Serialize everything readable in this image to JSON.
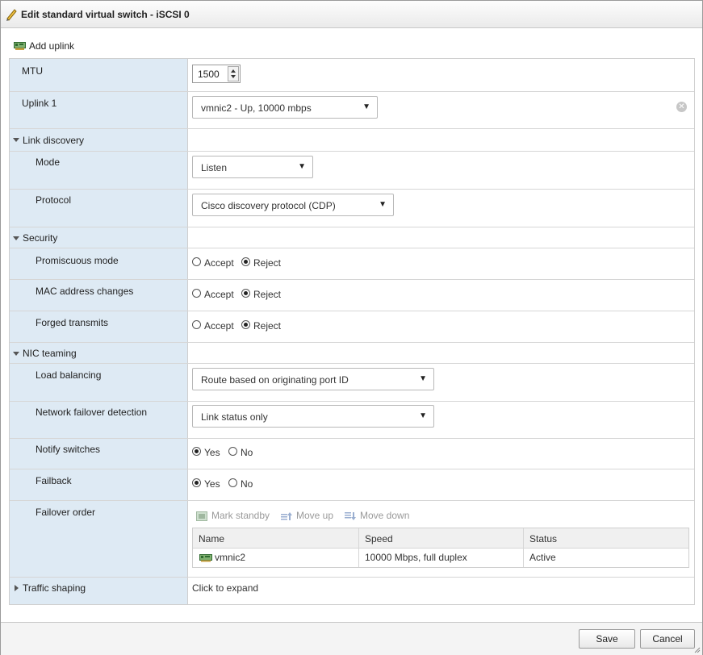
{
  "dialog": {
    "title": "Edit standard virtual switch - iSCSI 0"
  },
  "toolbar": {
    "add_uplink": "Add uplink"
  },
  "rows": {
    "mtu": {
      "label": "MTU",
      "value": "1500"
    },
    "uplink1": {
      "label": "Uplink 1",
      "value": "vmnic2 - Up, 10000 mbps"
    },
    "link_discovery": {
      "label": "Link discovery",
      "mode": {
        "label": "Mode",
        "value": "Listen"
      },
      "protocol": {
        "label": "Protocol",
        "value": "Cisco discovery protocol (CDP)"
      }
    },
    "security": {
      "label": "Security",
      "promiscuous": {
        "label": "Promiscuous mode",
        "selected": "Reject"
      },
      "mac_changes": {
        "label": "MAC address changes",
        "selected": "Reject"
      },
      "forged": {
        "label": "Forged transmits",
        "selected": "Reject"
      },
      "accept_label": "Accept",
      "reject_label": "Reject"
    },
    "nic_teaming": {
      "label": "NIC teaming",
      "load_balancing": {
        "label": "Load balancing",
        "value": "Route based on originating port ID"
      },
      "failover_detection": {
        "label": "Network failover detection",
        "value": "Link status only"
      },
      "notify_switches": {
        "label": "Notify switches",
        "selected": "Yes"
      },
      "failback": {
        "label": "Failback",
        "selected": "Yes"
      },
      "yes_label": "Yes",
      "no_label": "No",
      "failover_order": {
        "label": "Failover order",
        "actions": {
          "mark_standby": "Mark standby",
          "move_up": "Move up",
          "move_down": "Move down"
        },
        "columns": [
          "Name",
          "Speed",
          "Status"
        ],
        "rows": [
          {
            "name": "vmnic2",
            "speed": "10000 Mbps, full duplex",
            "status": "Active"
          }
        ]
      }
    },
    "traffic_shaping": {
      "label": "Traffic shaping",
      "value": "Click to expand"
    }
  },
  "footer": {
    "save": "Save",
    "cancel": "Cancel"
  },
  "icons": {
    "title": "pencil-icon",
    "add_uplink": "network-card-icon",
    "uplink_clear": "clear-icon",
    "mark_standby": "mark-standby-icon",
    "move_up": "move-up-icon",
    "move_down": "move-down-icon",
    "nic": "nic-icon"
  },
  "colors": {
    "label_column": "#deeaf4",
    "border": "#cfcfcf"
  }
}
